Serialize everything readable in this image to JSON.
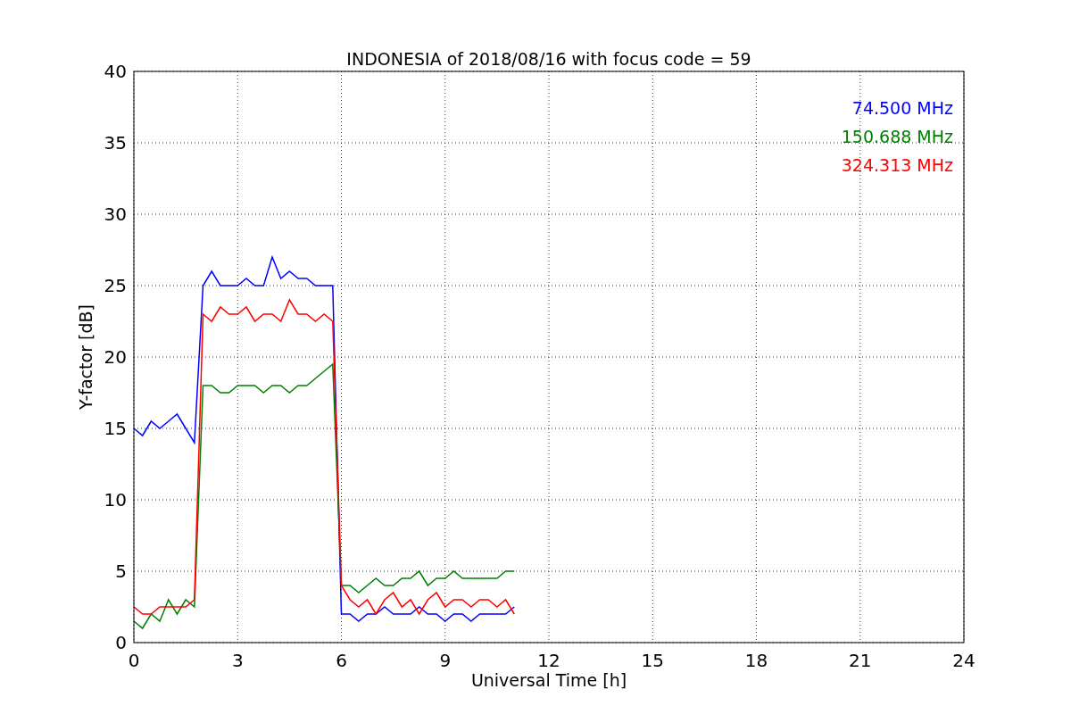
{
  "figure": {
    "chart_data": {
      "type": "line",
      "title": "INDONESIA of 2018/08/16 with focus code = 59",
      "xlabel": "Universal Time [h]",
      "ylabel": "Y-factor [dB]",
      "x": [
        0,
        0.25,
        0.5,
        0.75,
        1,
        1.25,
        1.5,
        1.75,
        2,
        2.25,
        2.5,
        2.75,
        3,
        3.25,
        3.5,
        3.75,
        4,
        4.25,
        4.5,
        4.75,
        5,
        5.25,
        5.5,
        5.75,
        6,
        6.25,
        6.5,
        6.75,
        7,
        7.25,
        7.5,
        7.75,
        8,
        8.25,
        8.5,
        8.75,
        9,
        9.25,
        9.5,
        9.75,
        10,
        10.25,
        10.5,
        10.75,
        11
      ],
      "series": [
        {
          "name": "74.500 MHz",
          "color": "#0000ff",
          "values": [
            15,
            14.5,
            15.5,
            15,
            15.5,
            16,
            15,
            14,
            25,
            26,
            25,
            25,
            25,
            25.5,
            25,
            25,
            27,
            25.5,
            26,
            25.5,
            25.5,
            25,
            25,
            25,
            2,
            2,
            1.5,
            2,
            2,
            2.5,
            2,
            2,
            2,
            2.5,
            2,
            2,
            1.5,
            2,
            2,
            1.5,
            2,
            2,
            2,
            2,
            2.5
          ]
        },
        {
          "name": "150.688 MHz",
          "color": "#008000",
          "values": [
            1.5,
            1,
            2,
            1.5,
            3,
            2,
            3,
            2.5,
            18,
            18,
            17.5,
            17.5,
            18,
            18,
            18,
            17.5,
            18,
            18,
            17.5,
            18,
            18,
            18.5,
            19,
            19.5,
            4,
            4,
            3.5,
            4,
            4.5,
            4,
            4,
            4.5,
            4.5,
            5,
            4,
            4.5,
            4.5,
            5,
            4.5,
            4.5,
            4.5,
            4.5,
            4.5,
            5,
            5
          ]
        },
        {
          "name": "324.313 MHz",
          "color": "#ff0000",
          "values": [
            2.5,
            2,
            2,
            2.5,
            2.5,
            2.5,
            2.5,
            3,
            23,
            22.5,
            23.5,
            23,
            23,
            23.5,
            22.5,
            23,
            23,
            22.5,
            24,
            23,
            23,
            22.5,
            23,
            22.5,
            4,
            3,
            2.5,
            3,
            2,
            3,
            3.5,
            2.5,
            3,
            2,
            3,
            3.5,
            2.5,
            3,
            3,
            2.5,
            3,
            3,
            2.5,
            3,
            2
          ]
        }
      ],
      "xlim": [
        0,
        24
      ],
      "ylim": [
        0,
        40
      ],
      "xticks": [
        0,
        3,
        6,
        9,
        12,
        15,
        18,
        21,
        24
      ],
      "yticks": [
        0,
        5,
        10,
        15,
        20,
        25,
        30,
        35,
        40
      ],
      "grid": true
    }
  }
}
